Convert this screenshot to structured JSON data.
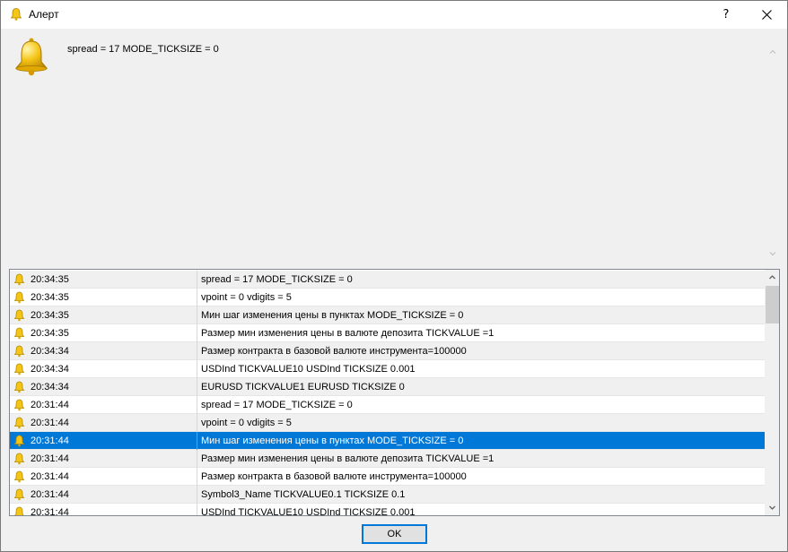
{
  "window": {
    "title": "Алерт",
    "help_glyph": "?",
    "close_glyph": "✕"
  },
  "message": {
    "text": "spread = 17 MODE_TICKSIZE = 0"
  },
  "list": {
    "rows": [
      {
        "time": "20:34:35",
        "message": "spread = 17 MODE_TICKSIZE = 0"
      },
      {
        "time": "20:34:35",
        "message": "vpoint = 0 vdigits = 5"
      },
      {
        "time": "20:34:35",
        "message": "Мин шаг изменения цены в пунктах MODE_TICKSIZE = 0"
      },
      {
        "time": "20:34:35",
        "message": "Размер мин изменения цены в валюте депозита TICKVALUE =1"
      },
      {
        "time": "20:34:34",
        "message": "Размер контракта в базовой валюте инструмента=100000"
      },
      {
        "time": "20:34:34",
        "message": "USDInd TICKVALUE10 USDInd TICKSIZE 0.001"
      },
      {
        "time": "20:34:34",
        "message": "EURUSD TICKVALUE1 EURUSD TICKSIZE 0"
      },
      {
        "time": "20:31:44",
        "message": "spread = 17 MODE_TICKSIZE = 0"
      },
      {
        "time": "20:31:44",
        "message": "vpoint = 0 vdigits = 5"
      },
      {
        "time": "20:31:44",
        "message": "Мин шаг изменения цены в пунктах MODE_TICKSIZE = 0"
      },
      {
        "time": "20:31:44",
        "message": "Размер мин изменения цены в валюте депозита TICKVALUE =1"
      },
      {
        "time": "20:31:44",
        "message": "Размер контракта в базовой валюте инструмента=100000"
      },
      {
        "time": "20:31:44",
        "message": "Symbol3_Name TICKVALUE0.1 TICKSIZE 0.1"
      },
      {
        "time": "20:31:44",
        "message": "USDInd TICKVALUE10 USDInd TICKSIZE 0.001"
      }
    ],
    "selected_index": 9
  },
  "buttons": {
    "ok_label": "OK"
  },
  "colors": {
    "selection": "#0078d7",
    "bell_yellow": "#f5c518"
  }
}
